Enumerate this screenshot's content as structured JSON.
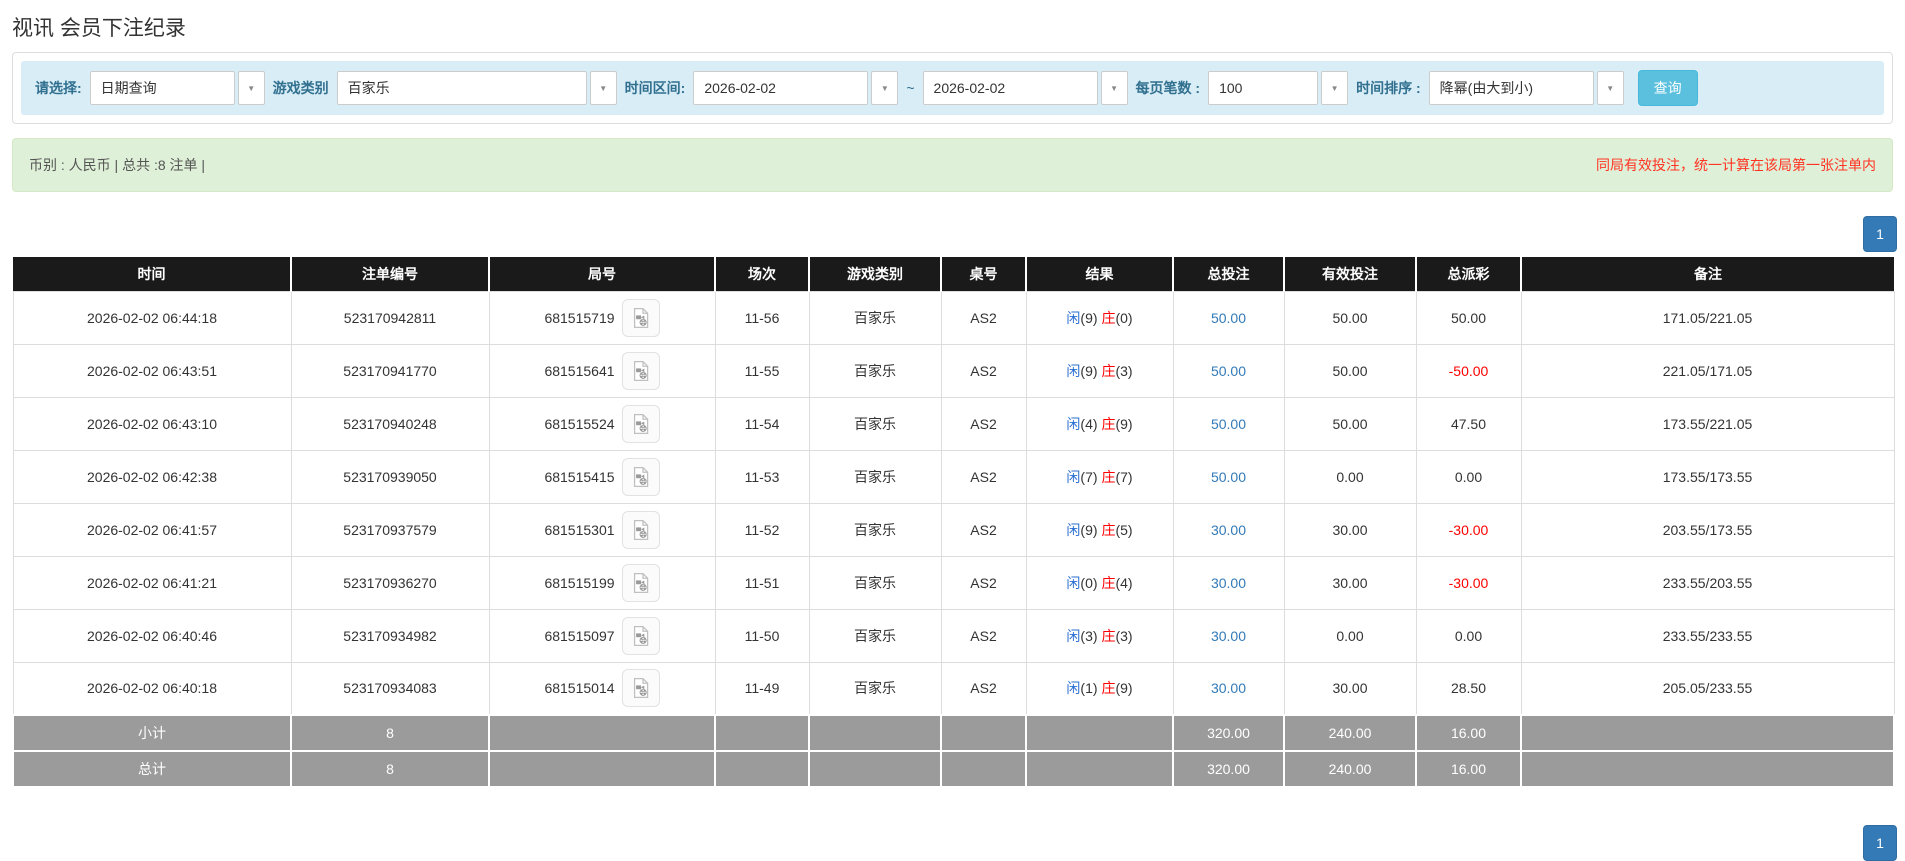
{
  "page": {
    "title": "视讯 会员下注纪录"
  },
  "filters": {
    "select_label": "请选择:",
    "select_value": "日期查询",
    "game_type_label": "游戏类别",
    "game_type_value": "百家乐",
    "time_range_label": "时间区间:",
    "date_from": "2026-02-02",
    "range_separator": "~",
    "date_to": "2026-02-02",
    "page_size_label": "每页笔数 :",
    "page_size_value": "100",
    "sort_label": "时间排序 :",
    "sort_value": "降幂(由大到小)",
    "search_button": "查询"
  },
  "summary": {
    "left_text": "币别 : 人民币 | 总共 :8 注单 |",
    "right_note": "同局有效投注，统一计算在该局第一张注单内"
  },
  "pagination": {
    "page": "1"
  },
  "colors": {
    "filter_bg": "#d9edf7",
    "summary_bg": "#dff0d8",
    "search_button": "#5bc0de",
    "header_bg": "#1a1a1a",
    "footer_bg": "#9b9b9b",
    "pagination_blue": "#337ab7",
    "link_blue": "#337ab7",
    "player_blue": "#2a6fd1",
    "banker_red": "#ff0000",
    "negative_red": "#ff0000",
    "note_red": "#ff3322"
  },
  "table": {
    "headers": [
      "时间",
      "注单编号",
      "局号",
      "场次",
      "游戏类别",
      "桌号",
      "结果",
      "总投注",
      "有效投注",
      "总派彩",
      "备注"
    ],
    "rows": [
      {
        "time": "2026-02-02 06:44:18",
        "bet_id": "523170942811",
        "round_id": "681515719",
        "session": "11-56",
        "game": "百家乐",
        "table_no": "AS2",
        "p_label": "闲",
        "p_score": "(9)",
        "b_label": "庄",
        "b_score": "(0)",
        "total_bet": "50.00",
        "valid_bet": "50.00",
        "payout": "50.00",
        "remark": "171.05/221.05"
      },
      {
        "time": "2026-02-02 06:43:51",
        "bet_id": "523170941770",
        "round_id": "681515641",
        "session": "11-55",
        "game": "百家乐",
        "table_no": "AS2",
        "p_label": "闲",
        "p_score": "(9)",
        "b_label": "庄",
        "b_score": "(3)",
        "total_bet": "50.00",
        "valid_bet": "50.00",
        "payout": "-50.00",
        "remark": "221.05/171.05"
      },
      {
        "time": "2026-02-02 06:43:10",
        "bet_id": "523170940248",
        "round_id": "681515524",
        "session": "11-54",
        "game": "百家乐",
        "table_no": "AS2",
        "p_label": "闲",
        "p_score": "(4)",
        "b_label": "庄",
        "b_score": "(9)",
        "total_bet": "50.00",
        "valid_bet": "50.00",
        "payout": "47.50",
        "remark": "173.55/221.05"
      },
      {
        "time": "2026-02-02 06:42:38",
        "bet_id": "523170939050",
        "round_id": "681515415",
        "session": "11-53",
        "game": "百家乐",
        "table_no": "AS2",
        "p_label": "闲",
        "p_score": "(7)",
        "b_label": "庄",
        "b_score": "(7)",
        "total_bet": "50.00",
        "valid_bet": "0.00",
        "payout": "0.00",
        "remark": "173.55/173.55"
      },
      {
        "time": "2026-02-02 06:41:57",
        "bet_id": "523170937579",
        "round_id": "681515301",
        "session": "11-52",
        "game": "百家乐",
        "table_no": "AS2",
        "p_label": "闲",
        "p_score": "(9)",
        "b_label": "庄",
        "b_score": "(5)",
        "total_bet": "30.00",
        "valid_bet": "30.00",
        "payout": "-30.00",
        "remark": "203.55/173.55"
      },
      {
        "time": "2026-02-02 06:41:21",
        "bet_id": "523170936270",
        "round_id": "681515199",
        "session": "11-51",
        "game": "百家乐",
        "table_no": "AS2",
        "p_label": "闲",
        "p_score": "(0)",
        "b_label": "庄",
        "b_score": "(4)",
        "total_bet": "30.00",
        "valid_bet": "30.00",
        "payout": "-30.00",
        "remark": "233.55/203.55"
      },
      {
        "time": "2026-02-02 06:40:46",
        "bet_id": "523170934982",
        "round_id": "681515097",
        "session": "11-50",
        "game": "百家乐",
        "table_no": "AS2",
        "p_label": "闲",
        "p_score": "(3)",
        "b_label": "庄",
        "b_score": "(3)",
        "total_bet": "30.00",
        "valid_bet": "0.00",
        "payout": "0.00",
        "remark": "233.55/233.55"
      },
      {
        "time": "2026-02-02 06:40:18",
        "bet_id": "523170934083",
        "round_id": "681515014",
        "session": "11-49",
        "game": "百家乐",
        "table_no": "AS2",
        "p_label": "闲",
        "p_score": "(1)",
        "b_label": "庄",
        "b_score": "(9)",
        "total_bet": "30.00",
        "valid_bet": "30.00",
        "payout": "28.50",
        "remark": "205.05/233.55"
      }
    ],
    "subtotal": {
      "label": "小计",
      "count": "8",
      "total_bet": "320.00",
      "valid_bet": "240.00",
      "payout": "16.00"
    },
    "total": {
      "label": "总计",
      "count": "8",
      "total_bet": "320.00",
      "valid_bet": "240.00",
      "payout": "16.00"
    }
  }
}
